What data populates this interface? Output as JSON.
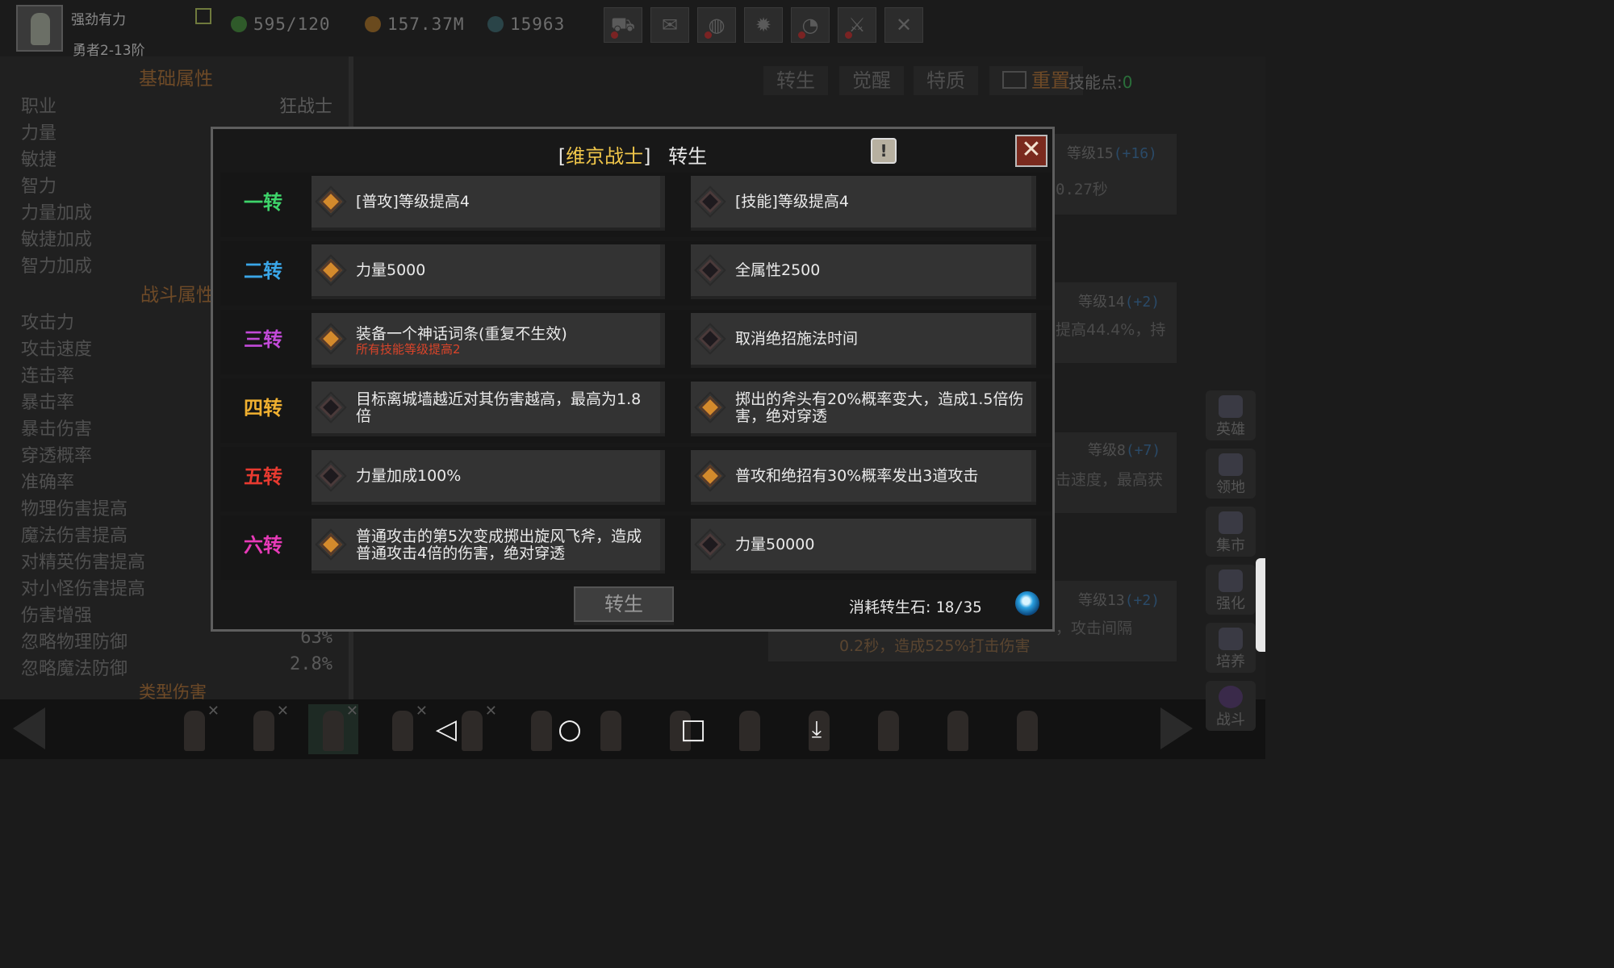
{
  "player": {
    "name": "强劲有力",
    "rank": "勇者2-13阶"
  },
  "resources": {
    "energy": "595/120",
    "gold": "157.37M",
    "gems": "15963"
  },
  "toolbar_icons": [
    "cart-icon",
    "mail-icon",
    "gamepad-icon",
    "gear-icon",
    "chart-icon",
    "swords-icon",
    "crossed-swords-icon"
  ],
  "left_panel": {
    "section_basic": "基础属性",
    "section_combat": "战斗属性",
    "section_bottom": "类型伤害",
    "basic_stats": [
      {
        "label": "职业",
        "value": "狂战士"
      },
      {
        "label": "力量",
        "value": ""
      },
      {
        "label": "敏捷",
        "value": ""
      },
      {
        "label": "智力",
        "value": ""
      },
      {
        "label": "力量加成",
        "value": ""
      },
      {
        "label": "敏捷加成",
        "value": ""
      },
      {
        "label": "智力加成",
        "value": ""
      }
    ],
    "combat_stats": [
      {
        "label": "攻击力",
        "value": ""
      },
      {
        "label": "攻击速度",
        "value": ""
      },
      {
        "label": "连击率",
        "value": ""
      },
      {
        "label": "暴击率",
        "value": ""
      },
      {
        "label": "暴击伤害",
        "value": ""
      },
      {
        "label": "穿透概率",
        "value": ""
      },
      {
        "label": "准确率",
        "value": ""
      },
      {
        "label": "物理伤害提高",
        "value": ""
      },
      {
        "label": "魔法伤害提高",
        "value": ""
      },
      {
        "label": "对精英伤害提高",
        "value": ""
      },
      {
        "label": "对小怪伤害提高",
        "value": ""
      },
      {
        "label": "伤害增强",
        "value": ""
      },
      {
        "label": "忽略物理防御",
        "value": "63%"
      },
      {
        "label": "忽略魔法防御",
        "value": "2.8%"
      }
    ]
  },
  "tabs": [
    "转生",
    "觉醒",
    "特质",
    "重置"
  ],
  "skill_points": {
    "label": "技能点:",
    "value": "0"
  },
  "skills_bg": [
    {
      "level": "等级15",
      "bonus": "(+16)",
      "desc": "0.27秒"
    },
    {
      "level": "等级14",
      "bonus": "(+2)",
      "desc": "提高44.4%，持"
    },
    {
      "level": "等级8",
      "bonus": "(+7)",
      "desc": "击速度，最高获"
    },
    {
      "level": "等级13",
      "bonus": "(+2)",
      "desc": "，攻击间隔",
      "desc2": "0.2秒，造成525%打击伤害"
    }
  ],
  "side_nav": [
    "英雄",
    "领地",
    "集市",
    "强化",
    "培养",
    "战斗"
  ],
  "modal": {
    "title_class": "维京战士",
    "title_bracket_open": "[",
    "title_bracket_close": "]",
    "title_suffix": "转生",
    "info_symbol": "!",
    "close_symbol": "✕",
    "tiers": [
      {
        "label": "一转",
        "color": "#3ed46a",
        "left": {
          "text": "[普攻]等级提高4",
          "selected": true
        },
        "right": {
          "text": "[技能]等级提高4",
          "selected": false
        }
      },
      {
        "label": "二转",
        "color": "#3aa6e8",
        "left": {
          "text": "力量5000",
          "selected": true
        },
        "right": {
          "text": "全属性2500",
          "selected": false
        }
      },
      {
        "label": "三转",
        "color": "#c24ad8",
        "left": {
          "text": "装备一个神话词条(重复不生效)",
          "sub": "所有技能等级提高2",
          "selected": true
        },
        "right": {
          "text": "取消绝招施法时间",
          "selected": false
        }
      },
      {
        "label": "四转",
        "color": "#f0b030",
        "left": {
          "text": "目标离城墙越近对其伤害越高，最高为1.8倍",
          "selected": false
        },
        "right": {
          "text": "掷出的斧头有20%概率变大，造成1.5倍伤害，绝对穿透",
          "selected": true
        }
      },
      {
        "label": "五转",
        "color": "#e83a30",
        "left": {
          "text": "力量加成100%",
          "selected": false
        },
        "right": {
          "text": "普攻和绝招有30%概率发出3道攻击",
          "selected": true
        }
      },
      {
        "label": "六转",
        "color": "#e83ab8",
        "left": {
          "text": "普通攻击的第5次变成掷出旋风飞斧，造成普通攻击4倍的伤害，绝对穿透",
          "selected": true
        },
        "right": {
          "text": "力量50000",
          "selected": false
        }
      }
    ],
    "rebirth_button": "转生",
    "cost_label": "消耗转生石:",
    "cost_value": "18/35"
  }
}
